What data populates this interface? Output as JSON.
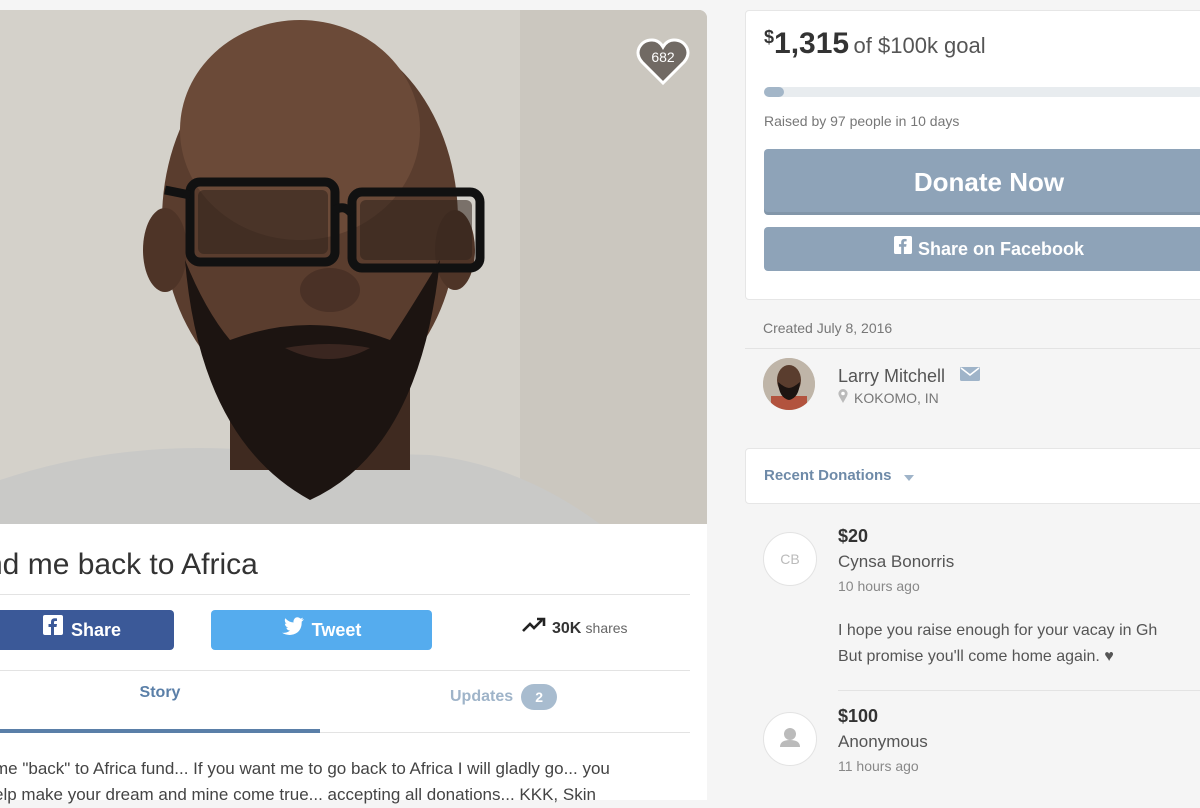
{
  "hero": {
    "hearts_count": "682"
  },
  "campaign": {
    "title": "nd me back to Africa",
    "share_label": "Share",
    "tweet_label": "Tweet",
    "shares_count": "30K",
    "shares_suffix": "shares",
    "tabs": [
      {
        "label": "Story"
      },
      {
        "label": "Updates",
        "badge": "2"
      }
    ],
    "story_lines": [
      "me \"back\" to Africa fund... If you want me to go back to Africa I will gladly go... you",
      "elp make your dream and mine come true... accepting  all donations... KKK, Skin"
    ]
  },
  "funding": {
    "amount_symbol": "$",
    "amount_value": "1,315",
    "goal_text": "of $100k goal",
    "progress_fraction": 0.013,
    "raised_by": "Raised by 97 people in 10 days",
    "donate_label": "Donate Now",
    "facebook_label": "Share on Facebook"
  },
  "organizer": {
    "created": "Created July 8, 2016",
    "name": "Larry Mitchell",
    "location": "KOKOMO, IN"
  },
  "recent_donations": {
    "label": "Recent Donations",
    "items": [
      {
        "initials": "CB",
        "amount": "$20",
        "name": "Cynsa Bonorris",
        "time": "10 hours ago",
        "message_lines": [
          "I hope you raise enough for your vacay in Gh",
          "But promise you'll come home again. ♥"
        ]
      },
      {
        "initials": "",
        "amount": "$100",
        "name": "Anonymous",
        "time": "11 hours ago"
      }
    ]
  },
  "colors": {
    "facebook": "#3b5998",
    "twitter": "#55acee",
    "muted_button": "#8ea3b8",
    "link": "#5a7fa8"
  }
}
